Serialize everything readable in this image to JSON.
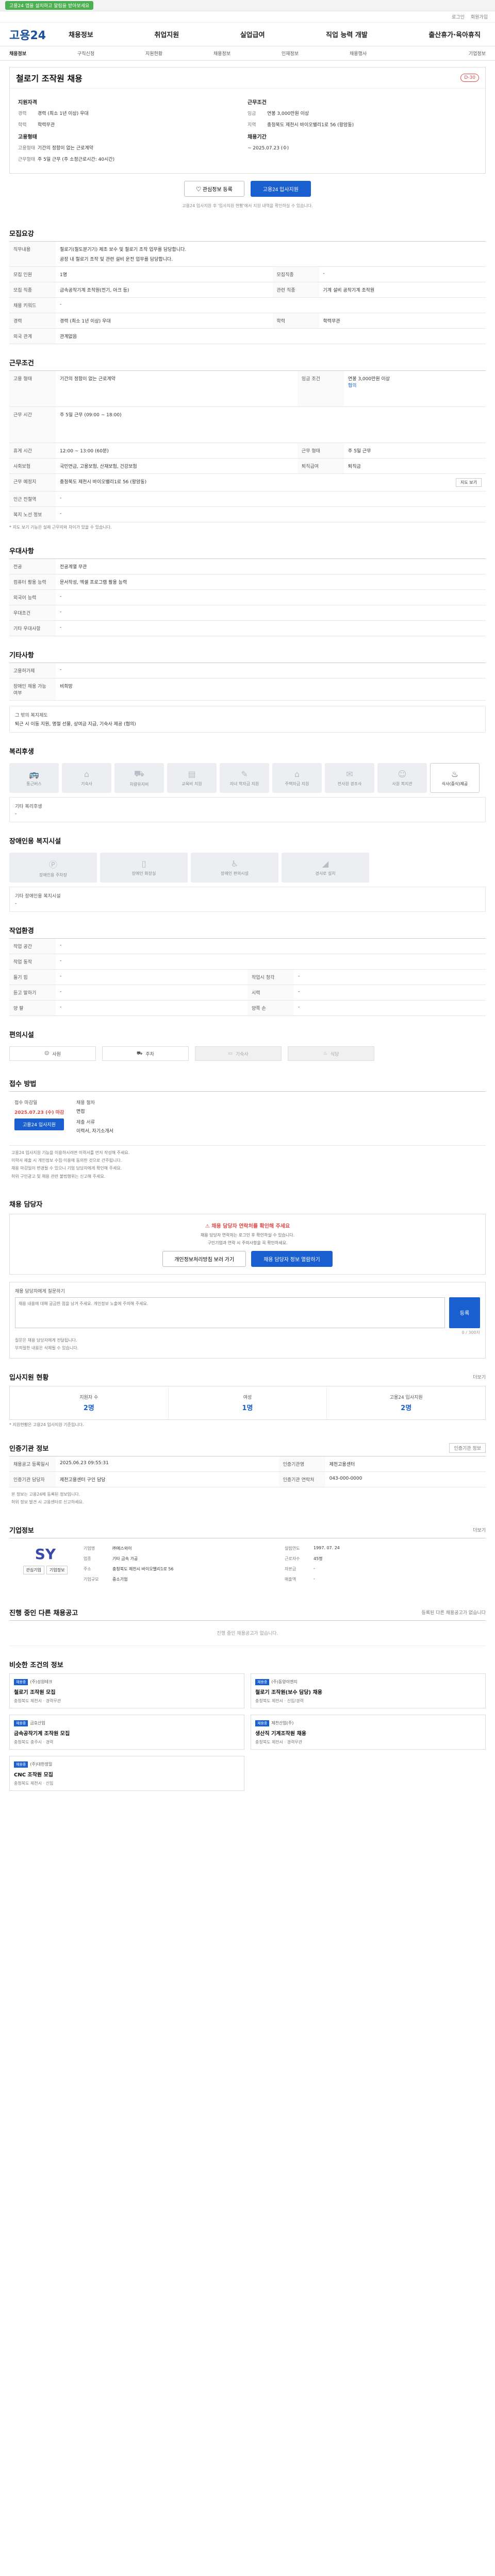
{
  "topbar": {
    "pill": "고용24 앱을 설치하고 알림을 받아보세요",
    "text": ""
  },
  "util": [
    "로그인",
    "회원가입"
  ],
  "brand": "고용24",
  "gnb": [
    "채용정보",
    "취업지원",
    "실업급여",
    "직업 능력 개발",
    "출산휴가·육아휴직"
  ],
  "lnb": [
    "채용정보",
    "구직신청",
    "지원현황",
    "채용정보",
    "인재정보",
    "채용행사",
    "기업정보"
  ],
  "job": {
    "title": "철로기 조작원 채용",
    "dday": "D-30",
    "applicant_sec": "지원자격",
    "rows_left": [
      {
        "k": "경력",
        "v": "경력 (최소 1년 이상) 우대"
      },
      {
        "k": "학력",
        "v": "학력무관"
      }
    ],
    "work_sec": "고용형태",
    "rows_left2": [
      {
        "k": "고용형태",
        "v": "기간의 정함이 없는 근로계약"
      },
      {
        "k": "근무형태",
        "v": "주 5일 근무 (주 소정근로시간: 40시간)"
      }
    ],
    "cond_sec": "근무조건",
    "rows_right": [
      {
        "k": "임금",
        "v": "연봉 3,000만원 이상"
      },
      {
        "k": "지역",
        "v": "충청북도 제천시 바이오밸리1로 56 (왕암동)"
      }
    ],
    "period_sec": "채용기간",
    "period": "~ 2025.07.23 (수)",
    "btn_interest": "관심정보 등록",
    "btn_apply": "고용24 입사지원",
    "notice": "고용24 입사지원 후 '입사지원 현황'에서 지원 내역을 확인하실 수 있습니다."
  },
  "recruit": {
    "title": "모집요강",
    "duty_label": "직무내용",
    "duty": "철로기(철도분기기) 제조 보수 및 철로기 조작 업무를 담당합니다.",
    "duty2": "공장 내 철로기 조작 및 관련 설비 운전 업무를 담당합니다.",
    "rows": [
      [
        "모집 인원",
        "1명",
        "모집직종",
        "-"
      ],
      [
        "모집 직종",
        "금속공작기계 조작원(전기, 아크 등)",
        "관련 직종",
        "기계 설비 공작기계 조작원"
      ],
      [
        "채용 키워드",
        "-",
        "",
        ""
      ],
      [
        "경력",
        "경력 (최소 1년 이상) 우대",
        "학력",
        "학력무관"
      ],
      [
        "외국 관계",
        "관계없음",
        "",
        ""
      ]
    ]
  },
  "cond": {
    "title": "근무조건",
    "rows": [
      [
        "고용 형태",
        "기간의 정함이 없는 근로계약",
        "임금 조건",
        "연봉 3,000만원 이상"
      ],
      [
        "근무 시간",
        "주 5일 근무 (09:00 ~ 18:00)",
        "",
        ""
      ],
      [
        "휴게 시간",
        "12:00 ~ 13:00 (60분)",
        "근무 형태",
        "주 5일 근무"
      ],
      [
        "사회보험",
        "국민연금, 고용보험, 산재보험, 건강보험",
        "퇴직급여",
        "퇴직금"
      ],
      [
        "근무 예정지",
        "충청북도 제천시 바이오밸리1로 56 (왕암동)",
        "",
        ""
      ],
      [
        "인근 전철역",
        "-",
        "",
        ""
      ],
      [
        "복지 노선 정보",
        "-",
        "",
        ""
      ]
    ],
    "pay_note": "협의",
    "map_btn": "지도 보기",
    "note": "* 지도 보기 기능은 실제 근무지와 차이가 있을 수 있습니다."
  },
  "prefer": {
    "title": "우대사항",
    "rows": [
      [
        "전공",
        "전공계열 무관"
      ],
      [
        "컴퓨터 활용 능력",
        "문서작성, 엑셀 프로그램 활용 능력"
      ],
      [
        "외국어 능력",
        "-"
      ],
      [
        "우대조건",
        "-"
      ],
      [
        "기타 우대사항",
        "-"
      ]
    ]
  },
  "etc": {
    "title": "기타사항",
    "rows": [
      [
        "고용허가제",
        "-"
      ],
      [
        "장애인 채용 가능 여부",
        "비희망"
      ]
    ],
    "extra_label": "그 밖의 복지제도",
    "extra": "퇴근 시 이동 지원, 명절 선물, 상여금 지급, 기숙사 제공 (협의)"
  },
  "welfare": {
    "title": "복리후생",
    "items": [
      "통근버스",
      "기숙사",
      "차량유지비",
      "교육비 지원",
      "자녀 학자금 지원",
      "주택자금 지원",
      "전사원 경조사",
      "사원 복지관",
      "식사(중식)제공"
    ],
    "active_index": 8,
    "other_label": "기타 복리후생",
    "other": "-"
  },
  "disabled": {
    "title": "장애인용 복지시설",
    "items": [
      "장애인용 주차장",
      "장애인 화장실",
      "장애인 편의시설",
      "경사로 설치"
    ],
    "other_label": "기타 장애인용 복지시설",
    "other": "-"
  },
  "env": {
    "title": "작업환경",
    "rows": [
      [
        "작업 공간",
        "-",
        "",
        ""
      ],
      [
        "작업 동작",
        "-",
        "",
        ""
      ],
      [
        "들기 힘",
        "-",
        "작업시 청각",
        "-"
      ],
      [
        "듣고 말하기",
        "-",
        "시력",
        "-"
      ],
      [
        "양 팔",
        "-",
        "양쪽 손",
        "-"
      ]
    ],
    "equip_title": "편의시설",
    "equip": [
      "사원",
      "주차",
      "기숙사",
      "식당"
    ]
  },
  "apply": {
    "title": "접수 방법",
    "period_label": "접수 마감일",
    "period": "2025.07.23 (수) 마감",
    "method_label": "채용 절차",
    "method": "면접",
    "doc_label": "제출 서류",
    "doc": "이력서, 자기소개서",
    "btn": "고용24 입사지원",
    "bullets": [
      "고용24 입사지원 기능을 이용하시려면 이력서를 먼저 작성해 주세요.",
      "이력서 제출 시 개인정보 수집·이용에 동의한 것으로 간주됩니다.",
      "채용 마감일이 변경될 수 있으니 기업 담당자에게 확인해 주세요.",
      "허위 구인광고 및 채용 관련 불법행위는 신고해 주세요."
    ]
  },
  "contact": {
    "title": "채용 담당자",
    "warn": "채용 담당자 연락처를 확인해 주세요",
    "lines": [
      "채용 담당자 연락처는 로그인 후 확인하실 수 있습니다.",
      "구인기업과 연락 시 주의사항을 꼭 확인하세요."
    ],
    "btn1": "개인정보처리방침 보러 가기",
    "btn2": "채용 담당자 정보 열람하기"
  },
  "qa": {
    "label": "채용 담당자에게 질문하기",
    "placeholder": "채용 내용에 대해 궁금한 점을 남겨 주세요. 개인정보 노출에 주의해 주세요.",
    "btn": "등록",
    "count": "0 / 300자",
    "notes": [
      "질문은 채용 담당자에게 전달됩니다.",
      "부적절한 내용은 삭제될 수 있습니다."
    ]
  },
  "stats": {
    "title": "입사지원 현황",
    "more": "더보기",
    "items": [
      {
        "label": "지원자 수",
        "v": "2명"
      },
      {
        "label": "여성",
        "v": "1명"
      },
      {
        "label": "고용24 입사지원",
        "v": "2명"
      }
    ],
    "note": "* 지원현황은 고용24 입사지원 기준입니다."
  },
  "org": {
    "title": "인증기관 정보",
    "btn": "인증기관 정보",
    "rows": [
      [
        "채용공고 등록일시",
        "2025.06.23 09:55:31",
        "인증기관명",
        "제천고용센터"
      ],
      [
        "인증기관 담당자",
        "제천고용센터 구인 담당",
        "인증기관 연락처",
        "043-000-0000"
      ]
    ],
    "notes": [
      "본 정보는 고용24에 등록된 정보입니다.",
      "허위 정보 발견 시 고용센터로 신고하세요."
    ]
  },
  "company": {
    "title": "기업정보",
    "more": "더보기",
    "logo": "SY",
    "btns": [
      "관심기업",
      "기업정보"
    ],
    "left": [
      [
        "기업명",
        "㈜에스와이"
      ],
      [
        "업종",
        "기타 금속 가공"
      ],
      [
        "주소",
        "충청북도 제천시 바이오밸리1로 56"
      ],
      [
        "기업규모",
        "중소기업"
      ]
    ],
    "right": [
      [
        "설립연도",
        "1997. 07. 24"
      ],
      [
        "근로자수",
        "45명"
      ],
      [
        "자본금",
        "-"
      ],
      [
        "매출액",
        "-"
      ]
    ]
  },
  "other": {
    "title": "진행 중인 다른 채용공고",
    "more": "등록된 다른 채용공고가 없습니다",
    "empty": "진행 중인 채용공고가 없습니다."
  },
  "recommend": {
    "title": "비슷한 조건의 정보",
    "items": [
      {
        "tag": "채용중",
        "co": "(주)성원테크",
        "tt": "철로기 조작원 모집",
        "mt": "충청북도 제천시 · 경력무관"
      },
      {
        "tag": "채용중",
        "co": "(주)동양이엔지",
        "tt": "철로기 조작원(보수 담당) 채용",
        "mt": "충청북도 제천시 · 신입/경력"
      },
      {
        "tag": "채용중",
        "co": "금호산업",
        "tt": "금속공작기계 조작원 모집",
        "mt": "충청북도 충주시 · 경력"
      },
      {
        "tag": "채용중",
        "co": "제천산업(주)",
        "tt": "생산직 기계조작원 채용",
        "mt": "충청북도 제천시 · 경력무관"
      },
      {
        "tag": "채용중",
        "co": "(주)대한정밀",
        "tt": "CNC 조작원 모집",
        "mt": "충청북도 제천시 · 신입"
      }
    ]
  }
}
